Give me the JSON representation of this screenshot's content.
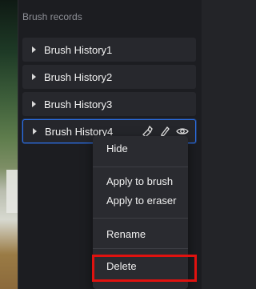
{
  "panel": {
    "title": "Brush records",
    "records": [
      {
        "label": "Brush History1"
      },
      {
        "label": "Brush History2"
      },
      {
        "label": "Brush History3"
      },
      {
        "label": "Brush History4",
        "active": true,
        "tools": [
          "eraser-brush-icon",
          "brush-icon",
          "eye-icon"
        ]
      }
    ]
  },
  "context_menu": {
    "items": [
      {
        "label": "Hide"
      },
      {
        "label": "Apply to brush"
      },
      {
        "label": "Apply to eraser"
      },
      {
        "label": "Rename"
      },
      {
        "label": "Delete",
        "highlighted": true
      }
    ]
  },
  "colors": {
    "accent_blue": "#2c6fe6",
    "highlight_red": "#e0120f",
    "panel_bg": "#1c1d21"
  }
}
